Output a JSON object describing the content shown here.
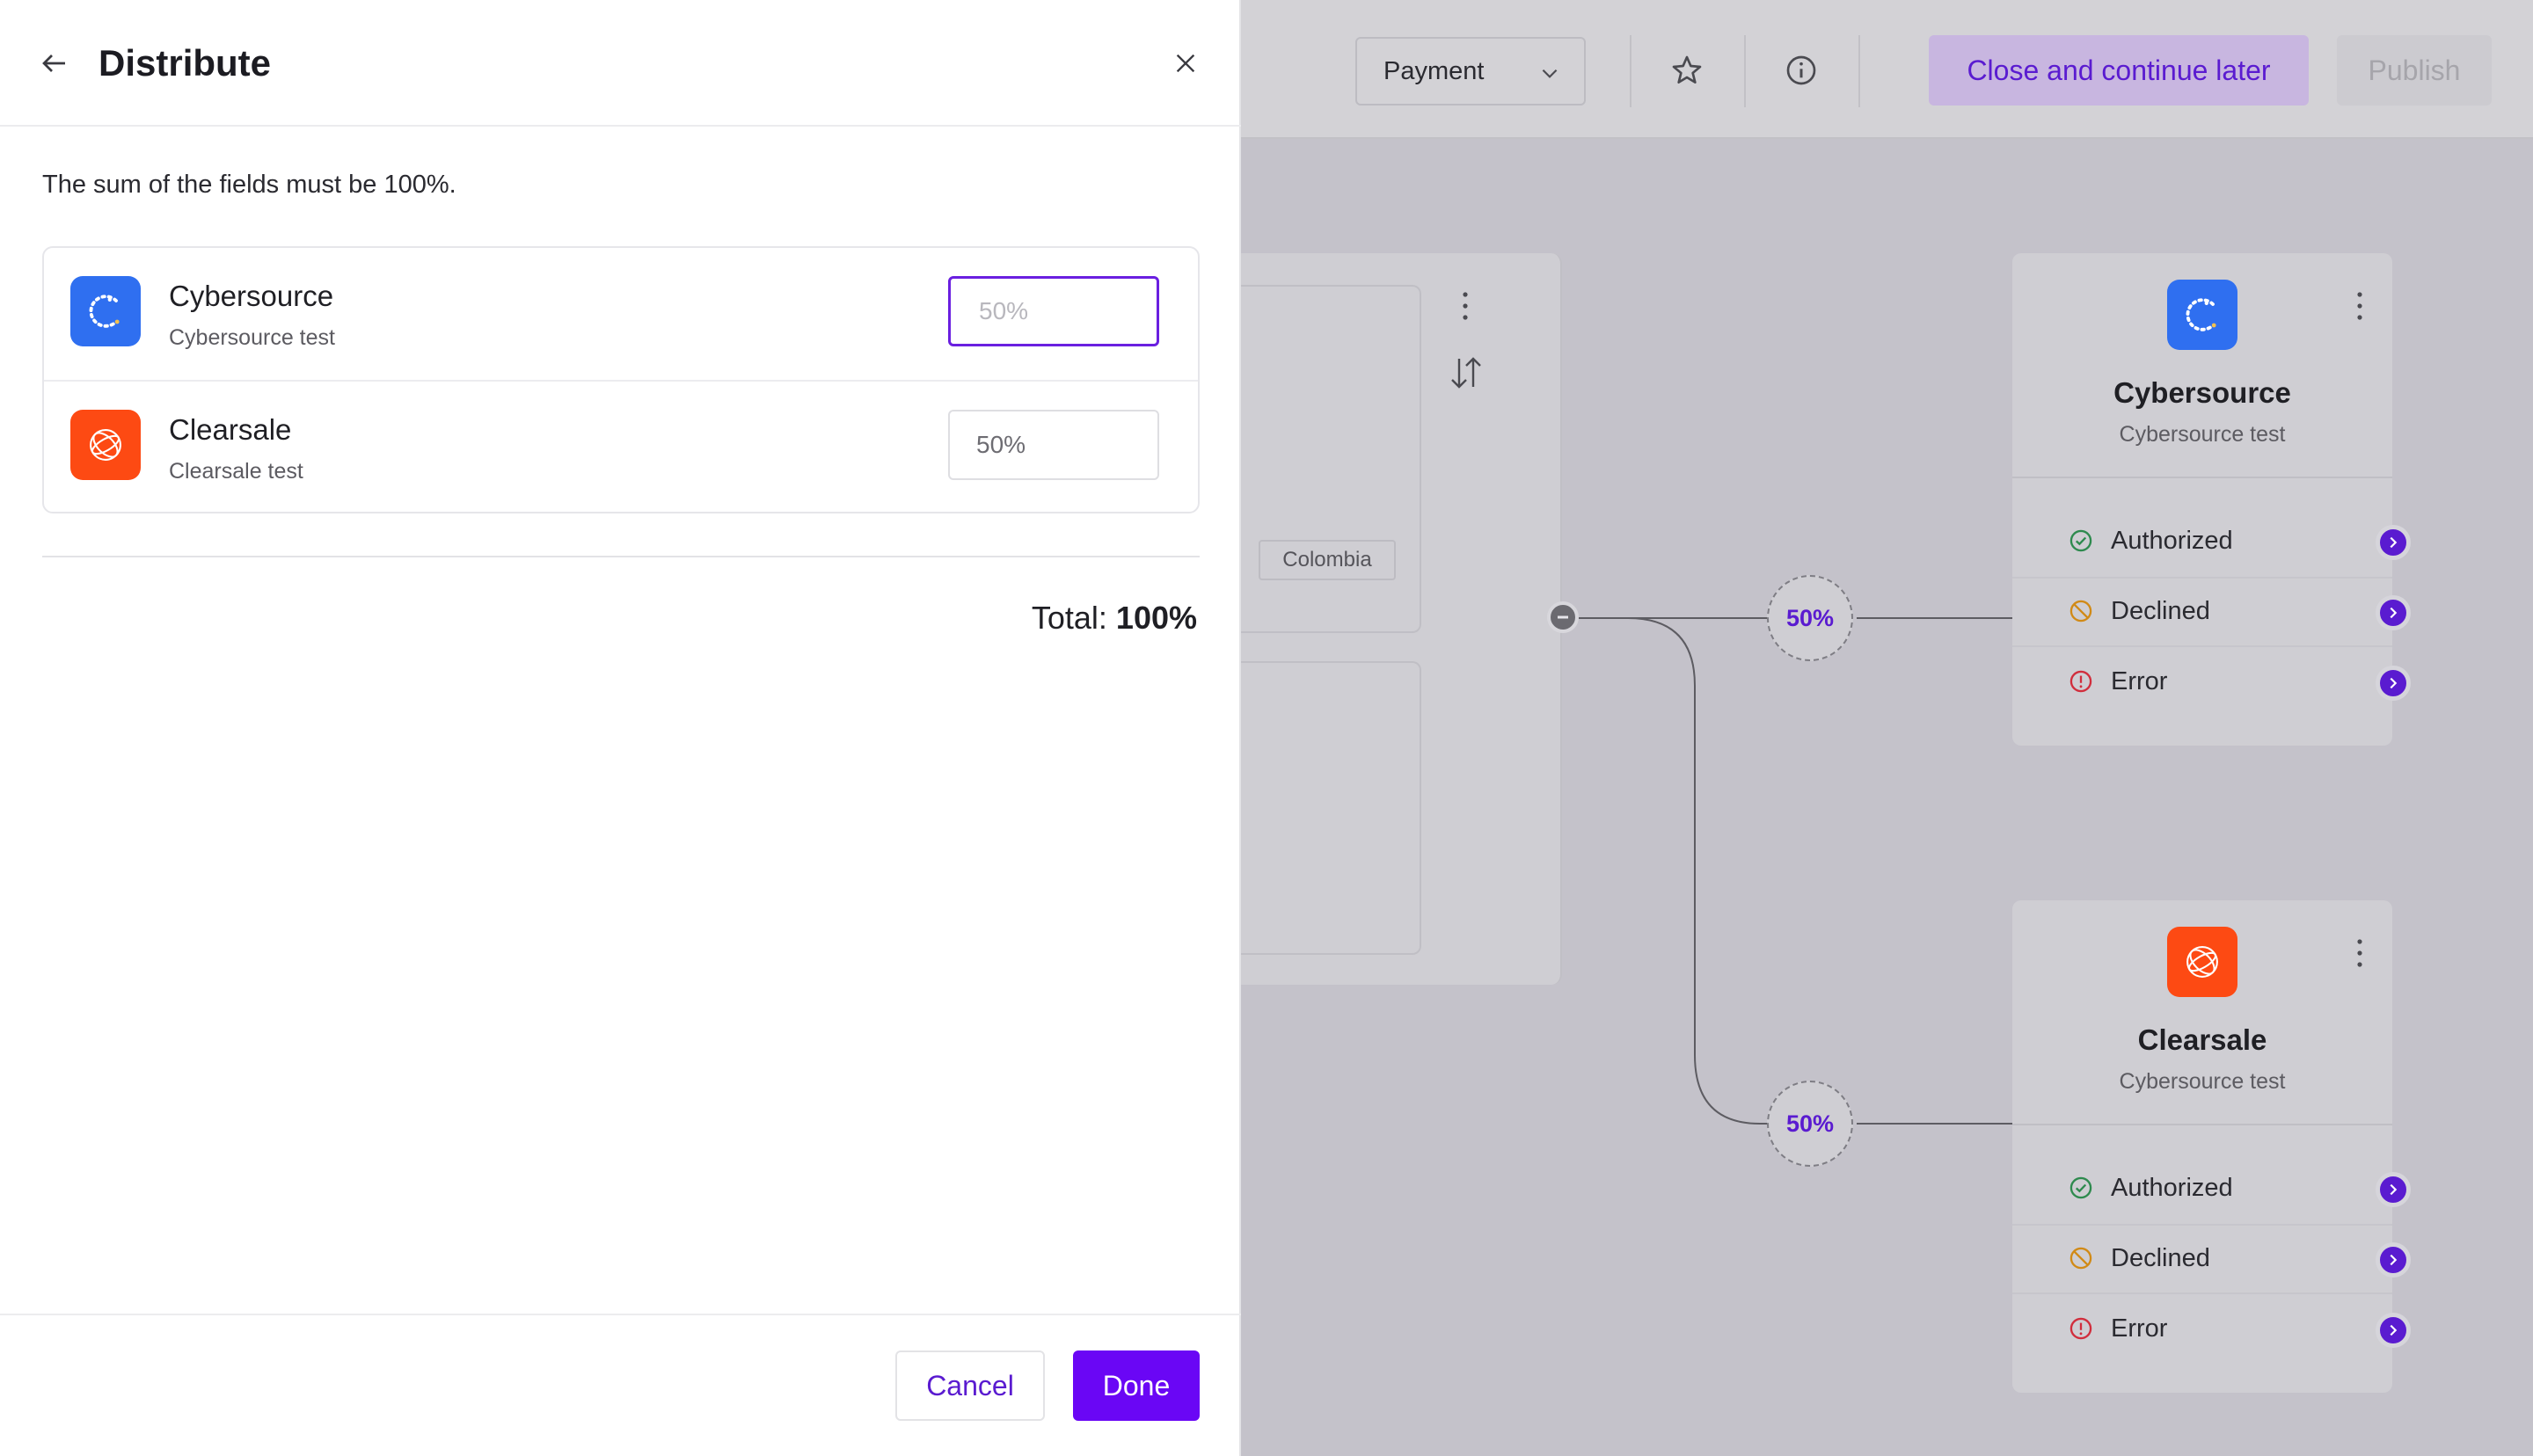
{
  "drawer": {
    "title": "Distribute",
    "hint": "The sum of the fields must be 100%.",
    "items": [
      {
        "name": "Cybersource",
        "subtitle": "Cybersource test",
        "value": "",
        "placeholder": "50%",
        "logo_color": "#2f6ff0"
      },
      {
        "name": "Clearsale",
        "subtitle": "Clearsale test",
        "value": "50%",
        "placeholder": "50%",
        "logo_color": "#fd4a13"
      }
    ],
    "total_label": "Total:",
    "total_value": "100%",
    "cancel_label": "Cancel",
    "done_label": "Done"
  },
  "toolbar": {
    "select_value": "Payment",
    "close_later_label": "Close and continue later",
    "publish_label": "Publish"
  },
  "canvas": {
    "country_tag": "Colombia",
    "splits": [
      "50%",
      "50%"
    ],
    "cards": [
      {
        "title": "Cybersource",
        "subtitle": "Cybersource test",
        "statuses": [
          "Authorized",
          "Declined",
          "Error"
        ]
      },
      {
        "title": "Clearsale",
        "subtitle": "Cybersource test",
        "statuses": [
          "Authorized",
          "Declined",
          "Error"
        ]
      }
    ]
  },
  "colors": {
    "accent": "#6a06f5",
    "accent_text": "#5a1bd0"
  }
}
